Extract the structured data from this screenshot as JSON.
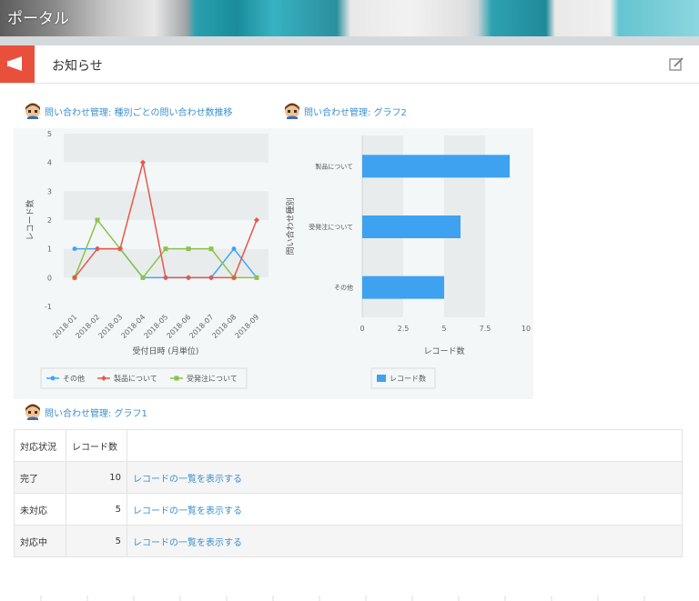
{
  "header": {
    "title": "ポータル"
  },
  "notice": {
    "title": "お知らせ",
    "flag_icon": "megaphone-icon",
    "edit_icon": "edit-icon"
  },
  "widgets": {
    "line_title": "問い合わせ管理: 種別ごとの問い合わせ数推移",
    "bar_title": "問い合わせ管理: グラフ2",
    "table_title": "問い合わせ管理: グラフ1"
  },
  "colors": {
    "blue": "#42a5f5",
    "red": "#e8574a",
    "green": "#8bc34a",
    "bar": "#3ea2f0",
    "link": "#3a8fd0",
    "flag": "#e9503c"
  },
  "chart_data": [
    {
      "type": "line",
      "categories": [
        "2018-01",
        "2018-02",
        "2018-03",
        "2018-04",
        "2018-05",
        "2018-06",
        "2018-07",
        "2018-08",
        "2018-09"
      ],
      "series": [
        {
          "name": "その他",
          "values": [
            1,
            1,
            1,
            0,
            0,
            0,
            0,
            1,
            0
          ]
        },
        {
          "name": "製品について",
          "values": [
            0,
            1,
            1,
            4,
            0,
            0,
            0,
            0,
            2
          ]
        },
        {
          "name": "受発注について",
          "values": [
            0,
            2,
            1,
            0,
            1,
            1,
            1,
            0,
            0
          ]
        }
      ],
      "xlabel": "受付日時 (月単位)",
      "ylabel": "レコード数",
      "ylim": [
        -1,
        5
      ],
      "yticks": [
        "5",
        "4",
        "3",
        "2",
        "1",
        "0",
        "-1"
      ],
      "legend": "bottom"
    },
    {
      "type": "bar",
      "orientation": "horizontal",
      "categories": [
        "製品について",
        "受発注について",
        "その他"
      ],
      "values": [
        9,
        6,
        5
      ],
      "xlabel": "レコード数",
      "ylabel": "問い合わせ種別",
      "xlim": [
        0,
        10
      ],
      "xticks": [
        "0",
        "2.5",
        "5",
        "7.5",
        "10"
      ],
      "legend": "bottom",
      "series_name": "レコード数"
    }
  ],
  "table": {
    "headers": [
      "対応状況",
      "レコード数",
      ""
    ],
    "rows": [
      {
        "status": "完了",
        "count": "10",
        "link": "レコードの一覧を表示する"
      },
      {
        "status": "未対応",
        "count": "5",
        "link": "レコードの一覧を表示する"
      },
      {
        "status": "対応中",
        "count": "5",
        "link": "レコードの一覧を表示する"
      }
    ]
  }
}
